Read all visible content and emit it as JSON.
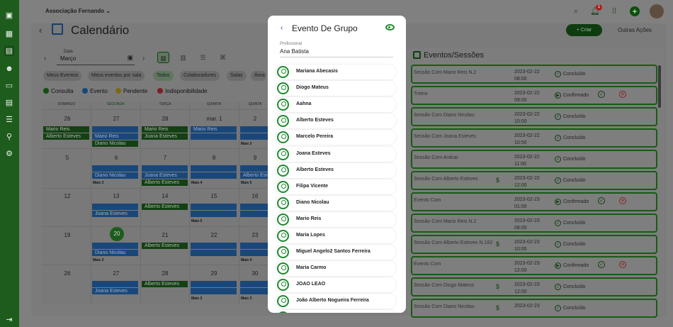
{
  "topbar": {
    "org": "Associação Fernando",
    "notif_count": "1"
  },
  "page": {
    "title": "Calendário",
    "criar": "+ Criar",
    "acoes": "Outras Ações"
  },
  "filters": {
    "date_label": "Data",
    "date_value": "Março",
    "chips": [
      "Meus Eventos",
      "Meus eventos por sala",
      "Todos",
      "Colaboradores",
      "Salas",
      "Área"
    ],
    "legend": [
      {
        "label": "Consulta",
        "color": "#1e8a2e"
      },
      {
        "label": "Evento",
        "color": "#1f6fc2"
      },
      {
        "label": "Pendente",
        "color": "#d4a000"
      },
      {
        "label": "Indisponibilidade",
        "color": "#c0303a"
      }
    ]
  },
  "calendar": {
    "days": [
      "DOMINGO",
      "SEGUNDA",
      "TERÇA",
      "QUARTA",
      "QUINTA"
    ],
    "weeks": [
      [
        "26",
        "27",
        "28",
        "mar. 1",
        "2"
      ],
      [
        "5",
        "6",
        "7",
        "8",
        "9"
      ],
      [
        "12",
        "13",
        "14",
        "15",
        "16"
      ],
      [
        "19",
        "20",
        "21",
        "22",
        "23"
      ],
      [
        "26",
        "27",
        "28",
        "29",
        "30"
      ]
    ],
    "events": {
      "mario": "Mario Reis",
      "alberto": "Alberto Esteves",
      "diano": "Diano Nicolau",
      "joana": "Joana Esteves"
    },
    "mais": [
      "Mais 3",
      "Mais 3",
      "Mais 3",
      "Mais 4",
      "Mais 5",
      "Mais 5",
      "Mais 4",
      "Mais 2",
      "Mais 3"
    ]
  },
  "sessions": {
    "title": "Eventos/Sessões",
    "items": [
      {
        "name": "Sessão Com Mario Reis N.2",
        "date": "2023-02-22",
        "time": "08:00",
        "status": "Concluído"
      },
      {
        "name": "Treino",
        "date": "2023-02-22",
        "time": "09:00",
        "status": "Confirmado"
      },
      {
        "name": "Sessão Com Diano Nicolau",
        "date": "2023-02-22",
        "time": "10:00",
        "status": "Concluído"
      },
      {
        "name": "Sessão Com Joana Esteves",
        "date": "2023-02-22",
        "time": "10:50",
        "status": "Concluído"
      },
      {
        "name": "Sessão Com Anilcar",
        "date": "2023-02-22",
        "time": "11:00",
        "status": "Concluído"
      },
      {
        "name": "Sessão Com Alberto Esteves",
        "date": "2023-02-22",
        "time": "12:00",
        "status": "Concluído"
      },
      {
        "name": "Evento Com",
        "date": "2023-02-23",
        "time": "01:00",
        "status": "Confirmado"
      },
      {
        "name": "Sessão Com Mario Reis N.2",
        "date": "2023-02-23",
        "time": "08:00",
        "status": "Concluído"
      },
      {
        "name": "Sessão Com Alberto Esteves N.162",
        "date": "2023-02-23",
        "time": "10:00",
        "status": "Concluído"
      },
      {
        "name": "Evento Com",
        "date": "2023-02-23",
        "time": "12:00",
        "status": "Confirmado"
      },
      {
        "name": "Sessão Com Diogo Mateus",
        "date": "2023-02-23",
        "time": "12:00",
        "status": "Concluído"
      },
      {
        "name": "Sessão Com Diano Nicolau",
        "date": "2023-02-23",
        "time": "",
        "status": "Concluído"
      }
    ]
  },
  "modal": {
    "title": "Evento De Grupo",
    "prof_label": "Profissional",
    "prof_value": "Ana Batista",
    "members": [
      "Mariana Abecasis",
      "Diogo Mateus",
      "Aahna",
      "Alberto Esteves",
      "Marcelo Pereira",
      "Joana Esteves",
      "Alberto Esteves",
      "Filipa Vicente",
      "Diano Nicolau",
      "Mario Reis",
      "Maria Lopes",
      "Miguel Angelo2 Santos Ferreira",
      "Maria Carmo",
      "JOAO LEAO",
      "João Alberto Nogueira Ferreira"
    ]
  }
}
